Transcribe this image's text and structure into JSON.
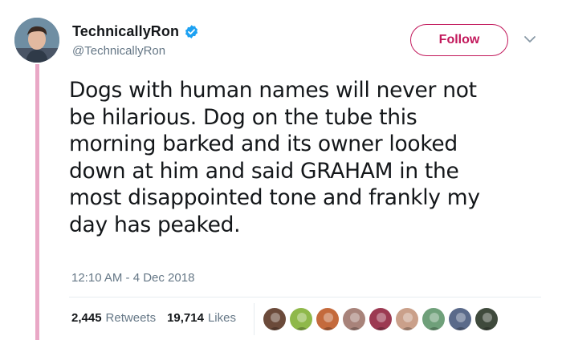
{
  "user": {
    "display_name": "TechnicallyRon",
    "handle": "@TechnicallyRon",
    "verified_icon": "verified-badge-icon",
    "accent_color": "#c2185b"
  },
  "follow_label": "Follow",
  "tweet": {
    "lines": [
      "Dogs with human names will never not",
      "be hilarious. Dog on the tube this",
      "morning barked and its owner looked",
      "down at him and said GRAHAM in the",
      "most disappointed tone and frankly my",
      "day has peaked."
    ],
    "timestamp": "12:10 AM - 4 Dec 2018"
  },
  "stats": {
    "retweets_count": "2,445",
    "retweets_label": "Retweets",
    "likes_count": "19,714",
    "likes_label": "Likes"
  },
  "likers": [
    {
      "name": "liker-avatar-1",
      "color": "#6b4a3a"
    },
    {
      "name": "liker-avatar-2",
      "color": "#8fb84a"
    },
    {
      "name": "liker-avatar-3",
      "color": "#c46a3c"
    },
    {
      "name": "liker-avatar-4",
      "color": "#a8837a"
    },
    {
      "name": "liker-avatar-5",
      "color": "#9c3a52"
    },
    {
      "name": "liker-avatar-6",
      "color": "#caa08a"
    },
    {
      "name": "liker-avatar-7",
      "color": "#6fa07a"
    },
    {
      "name": "liker-avatar-8",
      "color": "#5a6a8a"
    },
    {
      "name": "liker-avatar-9",
      "color": "#3f4a3c"
    }
  ]
}
